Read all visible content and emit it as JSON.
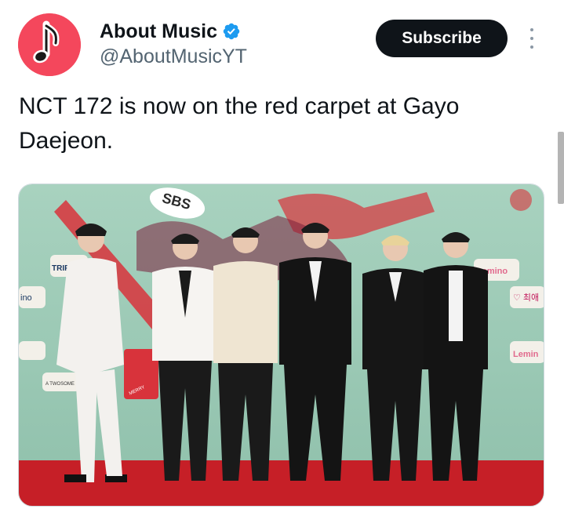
{
  "account": {
    "display_name": "About Music",
    "handle": "@AboutMusicYT",
    "verified": true,
    "avatar_icon": "music-note-icon",
    "avatar_color": "#f4475c"
  },
  "actions": {
    "subscribe_label": "Subscribe",
    "more_icon": "more-vertical-icon"
  },
  "tweet": {
    "text": "NCT 172 is now on the red carpet at Gayo Daejeon."
  },
  "media": {
    "backdrop_texts": [
      "SBS",
      "TRIPLE",
      "ino",
      "A TWOSOME",
      "MERRY",
      "Lemino",
      "Lemin",
      "♡ 최애"
    ],
    "colors": {
      "backdrop": "#9ecbb6",
      "carpet": "#c61f27",
      "accent": "#d8333b"
    },
    "people_count": 6
  },
  "colors": {
    "text": "#0f1419",
    "secondary_text": "#536471",
    "verified": "#1d9bf0",
    "button_bg": "#0f1419",
    "button_text": "#ffffff"
  }
}
